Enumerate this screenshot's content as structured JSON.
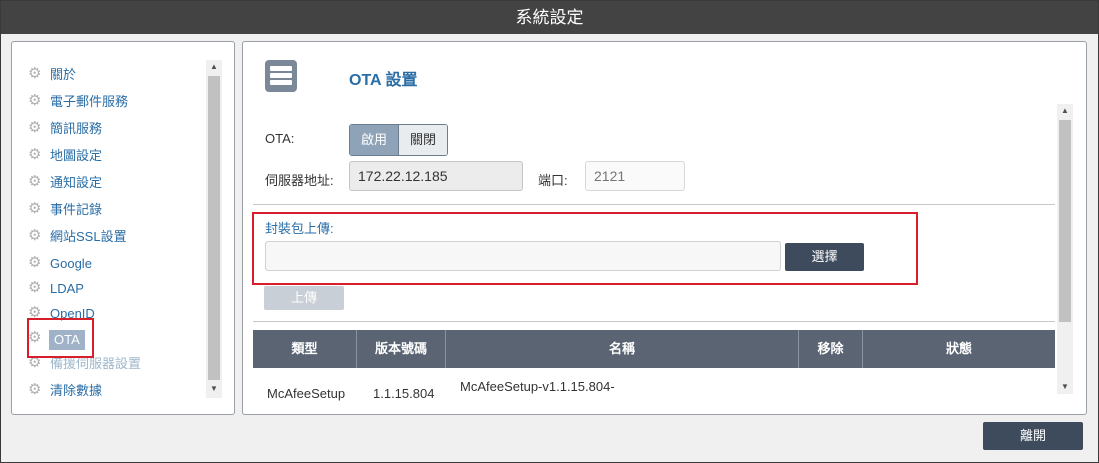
{
  "window": {
    "title": "系統設定"
  },
  "sidebar": {
    "items": [
      {
        "label": "關於"
      },
      {
        "label": "電子郵件服務"
      },
      {
        "label": "簡訊服務"
      },
      {
        "label": "地圖設定"
      },
      {
        "label": "通知設定"
      },
      {
        "label": "事件記錄"
      },
      {
        "label": "網站SSL設置"
      },
      {
        "label": "Google"
      },
      {
        "label": "LDAP"
      },
      {
        "label": "OpenID"
      },
      {
        "label": "OTA"
      },
      {
        "label": "備援伺服器設置"
      },
      {
        "label": "清除數據"
      }
    ],
    "active": "OTA"
  },
  "ota": {
    "title": "OTA 設置",
    "ota_label": "OTA:",
    "enable_label": "啟用",
    "disable_label": "關閉",
    "server_label": "伺服器地址:",
    "server_value": "172.22.12.185",
    "port_label": "端口:",
    "port_placeholder": "2121",
    "package_label": "封裝包上傳:",
    "file_value": "",
    "select_label": "選擇",
    "upload_label": "上傳"
  },
  "table": {
    "headers": [
      "類型",
      "版本號碼",
      "名稱",
      "移除",
      "狀態"
    ],
    "rows": [
      {
        "type": "McAfeeSetup",
        "version": "1.1.15.804",
        "name": "McAfeeSetup-v1.1.15.804-"
      }
    ]
  },
  "footer": {
    "leave_label": "離開"
  }
}
